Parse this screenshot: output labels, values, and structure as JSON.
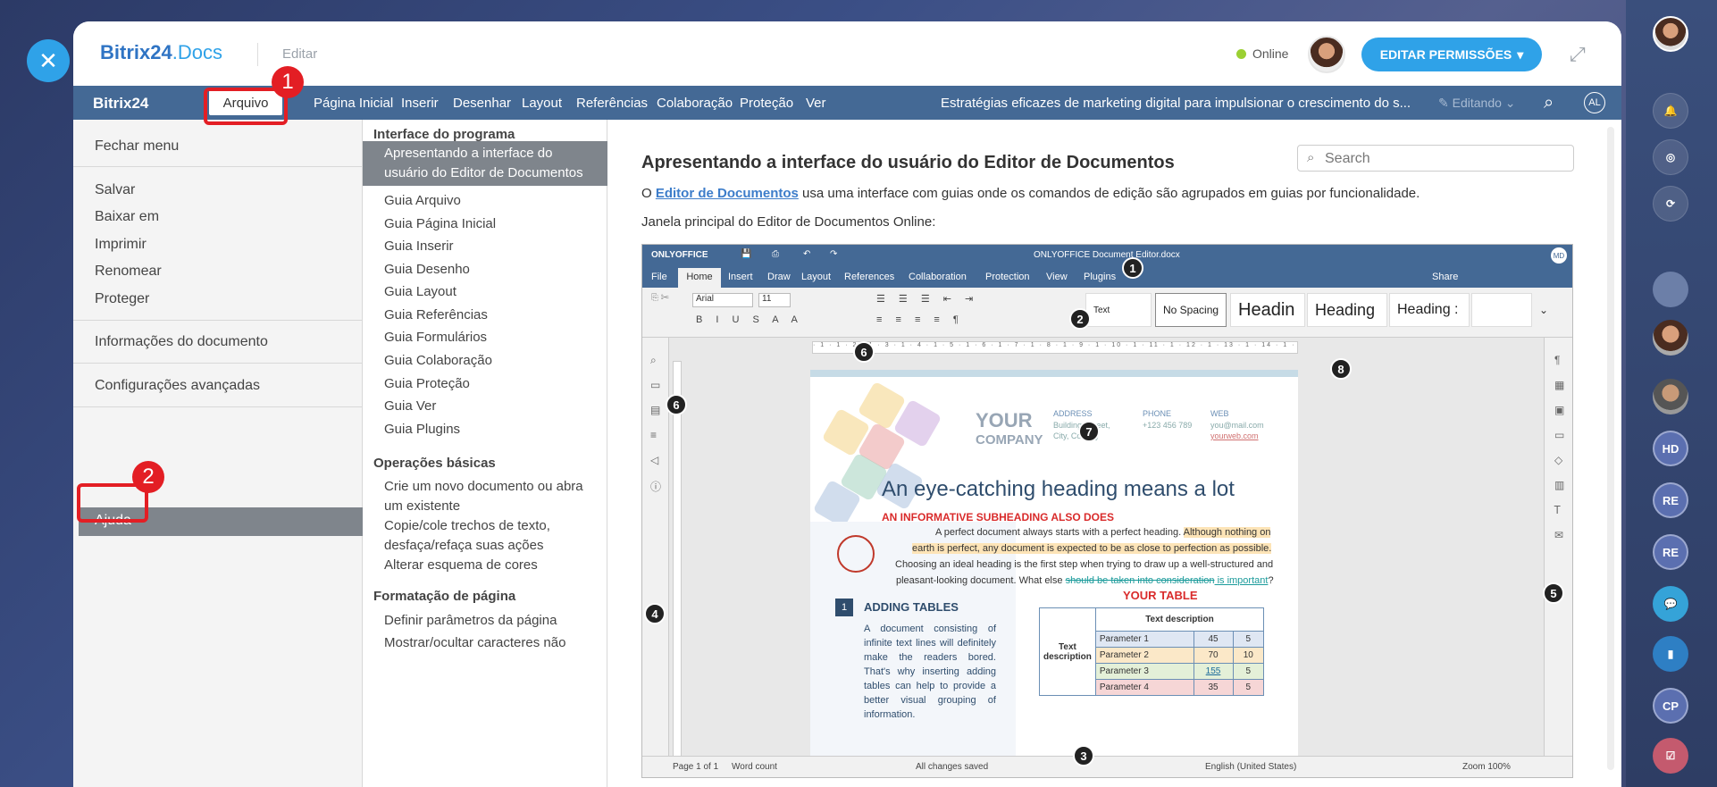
{
  "app": {
    "logo_main": "Bitrix24",
    "logo_docs": ".Docs",
    "edit_label": "Editar",
    "online_label": "Online",
    "permissions_button": "EDITAR PERMISSÕES",
    "close_glyph": "✕"
  },
  "menubar": {
    "brand": "Bitrix24",
    "tabs": [
      "Arquivo",
      "Página Inicial",
      "Inserir",
      "Desenhar",
      "Layout",
      "Referências",
      "Colaboração",
      "Proteção",
      "Ver"
    ],
    "doc_title": "Estratégias eficazes de marketing digital para impulsionar o crescimento do s...",
    "editing_label": "Editando",
    "user_initials": "AL"
  },
  "file_menu": {
    "close": "Fechar menu",
    "group1": [
      "Salvar",
      "Baixar em",
      "Imprimir",
      "Renomear",
      "Proteger"
    ],
    "info": "Informações do documento",
    "settings": "Configurações avançadas",
    "help": "Ajuda"
  },
  "toc": {
    "section1": "Interface do programa",
    "active": "Apresentando a interface do usuário do Editor de Documentos",
    "items1": [
      "Guia Arquivo",
      "Guia Página Inicial",
      "Guia Inserir",
      "Guia Desenho",
      "Guia Layout",
      "Guia Referências",
      "Guia Formulários",
      "Guia Colaboração",
      "Guia Proteção",
      "Guia Ver",
      "Guia Plugins"
    ],
    "section2": "Operações básicas",
    "items2": [
      "Crie um novo documento ou abra um existente",
      "Copie/cole trechos de texto, desfaça/refaça suas ações",
      "Alterar esquema de cores"
    ],
    "section3": "Formatação de página",
    "items3": [
      "Definir parâmetros da página",
      "Mostrar/ocultar caracteres não"
    ]
  },
  "content": {
    "title": "Apresentando a interface do usuário do Editor de Documentos",
    "search_placeholder": "Search",
    "p1_before": "O ",
    "p1_link": "Editor de Documentos",
    "p1_after": " usa uma interface com guias onde os comandos de edição são agrupados em guias por funcionalidade.",
    "p2": "Janela principal do Editor de Documentos Online:"
  },
  "editor": {
    "brand": "ONLYOFFICE",
    "filename": "ONLYOFFICE Document Editor.docx",
    "user": "MD",
    "tabs": [
      "File",
      "Home",
      "Insert",
      "Draw",
      "Layout",
      "References",
      "Collaboration",
      "Protection",
      "View",
      "Plugins"
    ],
    "share": "Share",
    "font": "Arial",
    "size": "11",
    "styles": [
      "Text",
      "No Spacing",
      "Headin",
      "Heading",
      "Heading :"
    ],
    "ruler": "· 1 · 1 · 2 · 1 · 3 · 1 · 4 · 1 · 5 · 1 · 6 · 1 · 7 · 1 · 8 · 1 · 9 · 1 · 10 · 1 · 11 · 1 · 12 · 1 · 13 · 1 · 14 · 1 · 15 · 1 · 16 · 1 · 17 ·",
    "status_page": "Page 1 of 1",
    "status_words": "Word count",
    "status_saved": "All changes saved",
    "status_lang": "English (United States)",
    "status_zoom": "Zoom 100%"
  },
  "document": {
    "company1": "YOUR",
    "company2": "COMPANY",
    "addr_h": "ADDRESS",
    "addr_t1": "Building, Street,",
    "addr_t2": "City, Country",
    "phone_h": "PHONE",
    "phone_t": "+123 456 789",
    "web_h": "WEB",
    "web_t1": "you@mail.com",
    "web_t2": "yourweb.com",
    "heading": "An eye-catching heading means a lot",
    "subheading": "AN INFORMATIVE SUBHEADING ALSO DOES",
    "l1a": "A perfect document always starts with a perfect heading. ",
    "l1b": "Although nothing on",
    "l2": "earth is perfect, any document is expected to be as close to perfection as possible.",
    "l3": "Choosing an ideal heading is the first step when trying to draw up a well-structured and",
    "l4a": "pleasant-looking document. What else ",
    "l4b": "should be taken into consideration",
    "l4c": " is important",
    "l4d": "?",
    "num": "1",
    "add_tables": "ADDING TABLES",
    "add_text": "A document consisting of infinite text lines will definitely make the readers bored. That's why inserting adding tables can help to provide a better visual grouping of information.",
    "your_table": "YOUR TABLE",
    "table_header": "Text description",
    "table_side": "Text description",
    "rows": [
      [
        "Parameter 1",
        "45",
        "5"
      ],
      [
        "Parameter 2",
        "70",
        "10"
      ],
      [
        "Parameter 3",
        "155",
        "5"
      ],
      [
        "Parameter 4",
        "35",
        "5"
      ]
    ]
  },
  "badges": [
    "1",
    "2",
    "3",
    "4",
    "5",
    "6",
    "7",
    "8"
  ],
  "annotations": [
    "1",
    "2"
  ],
  "rail": {
    "initials": [
      "HD",
      "RE",
      "RE",
      "CP"
    ]
  }
}
